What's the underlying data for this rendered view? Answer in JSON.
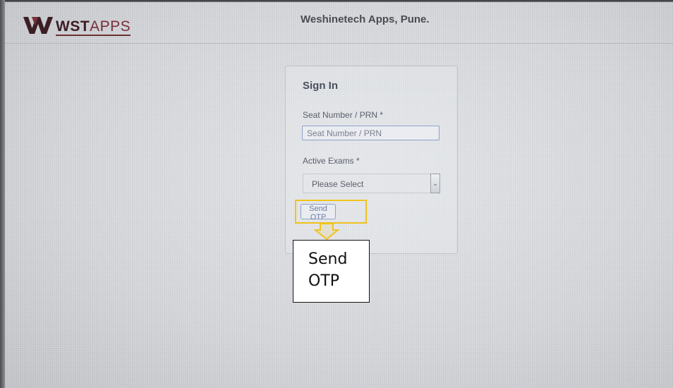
{
  "header": {
    "logo_text_bold": "WST",
    "logo_text_light": "APPS",
    "logo_icon": "w-logo-icon",
    "site_title": "Weshinetech Apps, Pune."
  },
  "signin": {
    "title": "Sign In",
    "seat_label": "Seat Number / PRN *",
    "seat_value": "",
    "seat_placeholder": "Seat Number / PRN",
    "exam_label": "Active Exams *",
    "exam_selected": "Please Select",
    "exam_dropdown_icon": "chevron-down-icon",
    "send_button": "Send OTP"
  },
  "annotation": {
    "line1": "Send",
    "line2": "OTP",
    "highlight_color": "#f0c31c"
  },
  "colors": {
    "brand_dark": "#3b1e24",
    "brand_accent": "#7a2f3a",
    "input_border": "#8ea2c4"
  }
}
